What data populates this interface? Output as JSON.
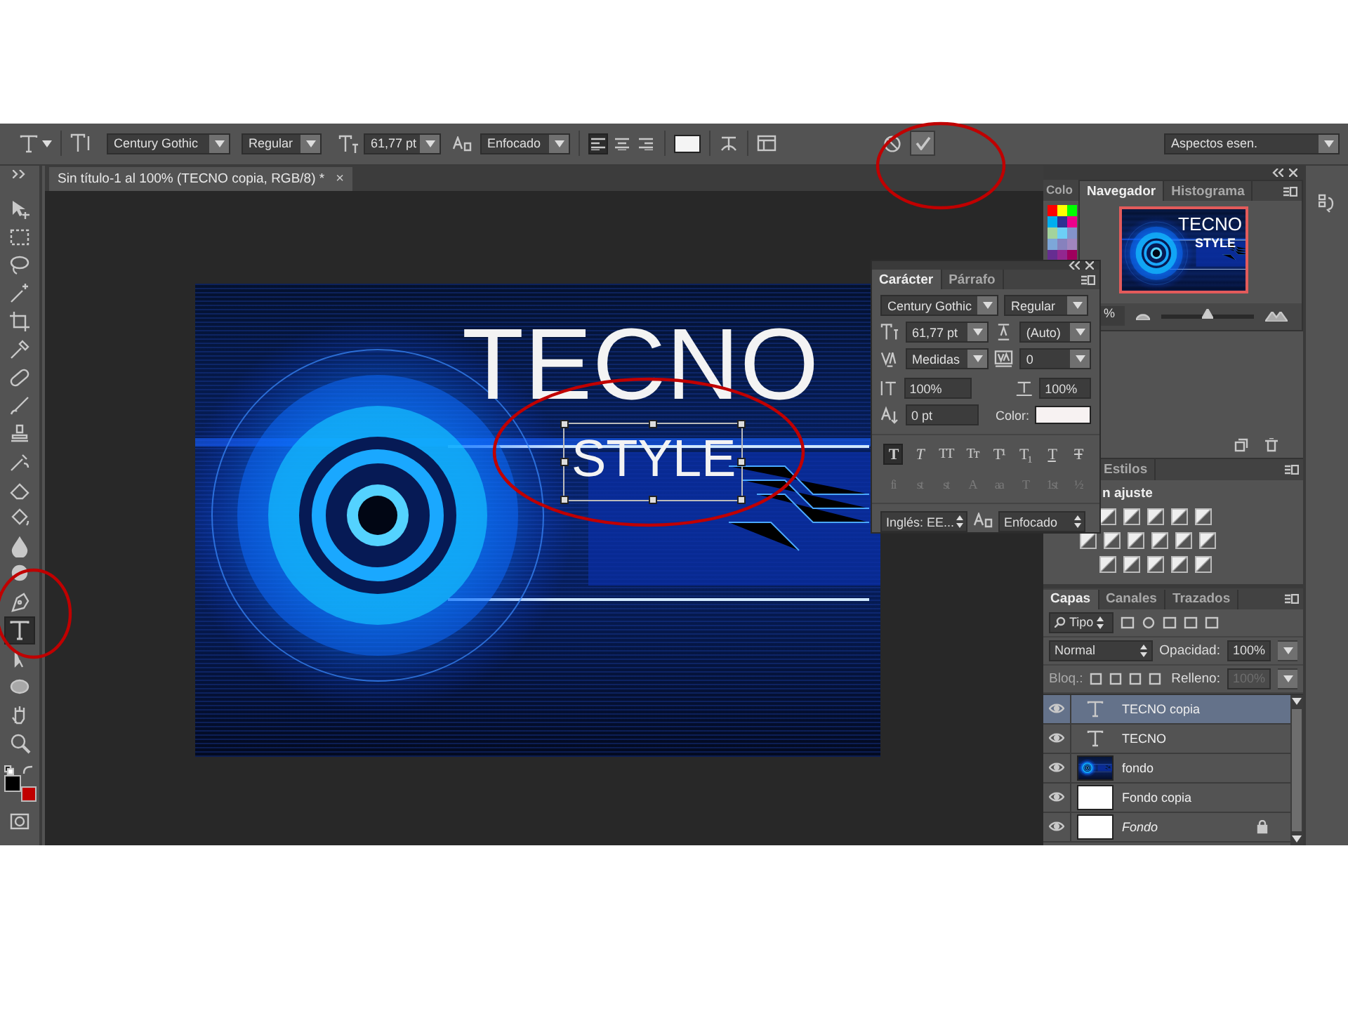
{
  "options_bar": {
    "font_family": "Century Gothic",
    "font_style": "Regular",
    "font_size": "61,77 pt",
    "antialias": "Enfocado",
    "alignment": [
      {
        "selected": true
      },
      {
        "selected": false
      },
      {
        "selected": false
      }
    ],
    "workspace": "Aspectos esen."
  },
  "tools": [
    {
      "kind": "move",
      "selected": false
    },
    {
      "kind": "marquee",
      "selected": false
    },
    {
      "kind": "lasso",
      "selected": false
    },
    {
      "kind": "wand",
      "selected": false
    },
    {
      "kind": "crop",
      "selected": false
    },
    {
      "kind": "eyedropper",
      "selected": false
    },
    {
      "kind": "healing",
      "selected": false
    },
    {
      "kind": "brush",
      "selected": false
    },
    {
      "kind": "stamp",
      "selected": false
    },
    {
      "kind": "history",
      "selected": false
    },
    {
      "kind": "eraser",
      "selected": false
    },
    {
      "kind": "bucket",
      "selected": false
    },
    {
      "kind": "blur",
      "selected": false
    },
    {
      "kind": "dodge",
      "selected": false
    },
    {
      "kind": "pen",
      "selected": false
    },
    {
      "kind": "type",
      "selected": true
    },
    {
      "kind": "path",
      "selected": false
    },
    {
      "kind": "ellipse",
      "selected": false
    },
    {
      "kind": "hand",
      "selected": false
    },
    {
      "kind": "zoom",
      "selected": false
    }
  ],
  "document": {
    "tab_title": "Sin título-1 al 100% (TECNO copia, RGB/8) *",
    "close": "×",
    "headline": "TECNO",
    "subline": "STYLE"
  },
  "character_panel": {
    "tabs": [
      {
        "label": "Carácter",
        "selected": true
      },
      {
        "label": "Párrafo",
        "selected": false
      }
    ],
    "font_family": "Century Gothic",
    "font_style": "Regular",
    "font_size": "61,77 pt",
    "leading": "(Auto)",
    "kerning": "Medidas",
    "tracking": "0",
    "vertical_scale": "100%",
    "horizontal_scale": "100%",
    "baseline_shift": "0 pt",
    "color_label": "Color:",
    "style_buttons": [
      {
        "label": "T",
        "kind": "bold",
        "selected": true
      },
      {
        "label": "T",
        "kind": "italic",
        "selected": false
      },
      {
        "label": "TT",
        "kind": "caps",
        "selected": false
      },
      {
        "label": "Tт",
        "kind": "smallcaps",
        "selected": false
      },
      {
        "label": "T¹",
        "kind": "super",
        "selected": false
      },
      {
        "label": "T₁",
        "kind": "sub",
        "selected": false
      },
      {
        "label": "T",
        "kind": "underline",
        "selected": false
      },
      {
        "label": "T",
        "kind": "strike",
        "selected": false
      }
    ],
    "opentype_buttons": [
      {
        "label": "fi",
        "disabled": true
      },
      {
        "label": "st",
        "disabled": true
      },
      {
        "label": "st",
        "disabled": true
      },
      {
        "label": "A",
        "disabled": true
      },
      {
        "label": "aa",
        "disabled": true
      },
      {
        "label": "T",
        "disabled": true
      },
      {
        "label": "1st",
        "disabled": true
      },
      {
        "label": "½",
        "disabled": true
      }
    ],
    "language": "Inglés: EE...",
    "antialias": "Enfocado"
  },
  "color_panel": {
    "tab": "Colo",
    "swatches": [
      {
        "color": "#ff0000"
      },
      {
        "color": "#ffff00"
      },
      {
        "color": "#00ff00"
      },
      {
        "color": "#00aeef"
      },
      {
        "color": "#2e3192"
      },
      {
        "color": "#ec008c"
      },
      {
        "color": "#a3d39c"
      },
      {
        "color": "#6dcff6"
      },
      {
        "color": "#8493ca"
      },
      {
        "color": "#7da7d9"
      },
      {
        "color": "#8781bd"
      },
      {
        "color": "#a186be"
      },
      {
        "color": "#662d91"
      },
      {
        "color": "#92278f"
      },
      {
        "color": "#9e005d"
      }
    ]
  },
  "navigator": {
    "tabs": [
      {
        "label": "Navegador",
        "selected": true
      },
      {
        "label": "Histograma",
        "selected": false
      }
    ],
    "headline": "TECNO",
    "subline": "STYLE",
    "zoom": {
      "reading": "%",
      "level": 0.5
    }
  },
  "adjustments": {
    "tab": "Estilos",
    "heading": "n ajuste"
  },
  "layers_panel": {
    "tabs": [
      {
        "label": "Capas",
        "selected": true
      },
      {
        "label": "Canales",
        "selected": false
      },
      {
        "label": "Trazados",
        "selected": false
      }
    ],
    "filter": "Tipo",
    "blend_mode": "Normal",
    "opacity_label": "Opacidad:",
    "opacity": "100%",
    "lock_label": "Bloq.:",
    "fill_label": "Relleno:",
    "fill": "100%",
    "fill_disabled": true,
    "layers": [
      {
        "name": "TECNO copia",
        "kind": "text",
        "selected": true,
        "visible": true,
        "locked": false
      },
      {
        "name": "TECNO",
        "kind": "text",
        "selected": false,
        "visible": true,
        "locked": false
      },
      {
        "name": "fondo",
        "kind": "image",
        "selected": false,
        "visible": true,
        "locked": false
      },
      {
        "name": "Fondo copia",
        "kind": "blank",
        "selected": false,
        "visible": true,
        "locked": false
      },
      {
        "name": "Fondo",
        "kind": "background",
        "selected": false,
        "visible": true,
        "locked": true
      }
    ]
  }
}
